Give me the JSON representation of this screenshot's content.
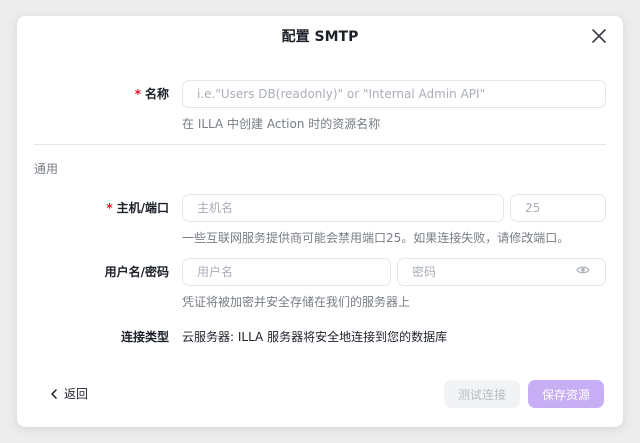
{
  "modal": {
    "title": "配置 SMTP",
    "close_icon": "close-icon"
  },
  "name_field": {
    "required_mark": "*",
    "label": "名称",
    "placeholder": "i.e.\"Users DB(readonly)\" or \"Internal Admin API\"",
    "value": "",
    "hint": "在 ILLA 中创建 Action 时的资源名称"
  },
  "general_section": {
    "title": "通用"
  },
  "host_port": {
    "required_mark": "*",
    "label": "主机/端口",
    "host_placeholder": "主机名",
    "host_value": "",
    "port_placeholder": "25",
    "port_value": "",
    "hint": "一些互联网服务提供商可能会禁用端口25。如果连接失败，请修改端口。"
  },
  "credentials": {
    "label": "用户名/密码",
    "username_placeholder": "用户名",
    "username_value": "",
    "password_placeholder": "密码",
    "password_value": "",
    "password_icon": "eye-icon",
    "hint": "凭证将被加密并安全存储在我们的服务器上"
  },
  "connection": {
    "label": "连接类型",
    "value": "云服务器: ILLA 服务器将安全地连接到您的数据库"
  },
  "footer": {
    "back_label": "返回",
    "test_label": "测试连接",
    "save_label": "保存资源"
  },
  "colors": {
    "accent": "#c8aef5",
    "required": "#eb0f29",
    "hint": "#787e85",
    "border": "#e5e6eb"
  }
}
